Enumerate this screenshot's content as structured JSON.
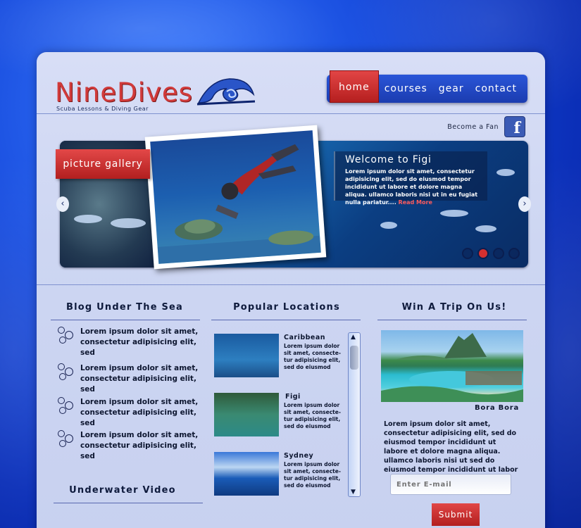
{
  "brand": {
    "name": "NineDives",
    "tagline": "Scuba Lessons & Diving Gear"
  },
  "nav": {
    "items": [
      "home",
      "courses",
      "gear",
      "contact"
    ],
    "active": "home"
  },
  "social": {
    "label": "Become a Fan",
    "icon": "facebook-icon"
  },
  "slider": {
    "gallery_label": "picture gallery",
    "welcome_title": "Welcome to Figi",
    "welcome_text": "Lorem ipsum dolor sit amet, consectetur adipisicing elit, sed do eiusmod tempor incididunt ut labore et dolore magna aliqua. ullamco laboris nisi ut in eu fugiat nulla pariatur....",
    "read_more": "Read More",
    "prev_icon": "chevron-left-icon",
    "next_icon": "chevron-right-icon",
    "dots_count": 4,
    "active_dot": 2
  },
  "blog": {
    "title": "Blog Under The Sea",
    "items": [
      "Lorem ipsum dolor sit amet, consectetur adipisicing elit, sed",
      "Lorem ipsum dolor sit amet, consectetur adipisicing elit, sed",
      "Lorem ipsum dolor sit amet, consectetur adipisicing elit, sed",
      "Lorem ipsum dolor sit amet, consectetur adipisicing elit, sed"
    ]
  },
  "video": {
    "title": "Underwater Video"
  },
  "locations": {
    "title": "Popular Locations",
    "items": [
      {
        "name": "Caribbean",
        "text": "Lorem ipsum dolor sit amet, consecte-tur adipisicing elit, sed do eiusmod"
      },
      {
        "name": "Figi",
        "text": "Lorem ipsum dolor sit amet, consecte-tur adipisicing elit, sed do eiusmod"
      },
      {
        "name": "Sydney",
        "text": "Lorem ipsum dolor sit amet, consecte-tur adipisicing elit, sed do eiusmod"
      }
    ]
  },
  "trip": {
    "title": "Win A Trip On Us!",
    "caption": "Bora Bora",
    "text": "Lorem ipsum dolor sit amet, consectetur adipisicing elit, sed do eiusmod tempor incididunt ut labore et dolore magna aliqua.  ullamco laboris nisi ut sed do eiusmod tempor incididunt ut labor",
    "email_placeholder": "Enter E-mail",
    "submit_label": "Submit"
  },
  "colors": {
    "accent": "#d13a3a",
    "nav": "#1b3cb0",
    "panel": "#cdd6f2"
  }
}
